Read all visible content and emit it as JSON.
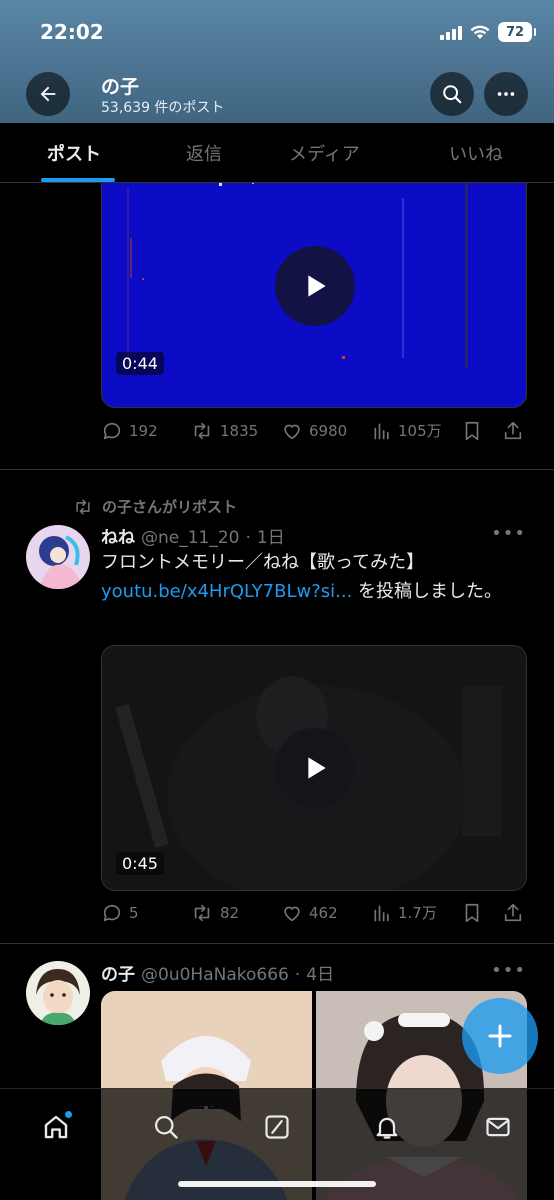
{
  "status_bar": {
    "time": "22:02",
    "battery": "72"
  },
  "header": {
    "title": "の子",
    "subtitle": "53,639 件のポスト"
  },
  "tabs": [
    {
      "label": "ポスト",
      "active": true
    },
    {
      "label": "返信",
      "active": false
    },
    {
      "label": "メディア",
      "active": false
    },
    {
      "label": "いいね",
      "active": false
    }
  ],
  "posts": [
    {
      "media": {
        "type": "video",
        "duration": "0:44",
        "color": "#0c0cc6"
      },
      "stats": {
        "replies": "192",
        "reposts": "1835",
        "likes": "6980",
        "views": "105万"
      }
    },
    {
      "repost_label": "の子さんがリポスト",
      "author": {
        "name": "ねね",
        "handle": "@ne_11_20",
        "time": "1日"
      },
      "text_before": "フロントメモリー／ねね【歌ってみた】",
      "link": "youtu.be/x4HrQLY7BLw?si...",
      "text_after": " を投稿しました。",
      "media": {
        "type": "video",
        "duration": "0:45"
      },
      "stats": {
        "replies": "5",
        "reposts": "82",
        "likes": "462",
        "views": "1.7万"
      }
    },
    {
      "author": {
        "name": "の子",
        "handle": "@0u0HaNako666",
        "time": "4日"
      },
      "media": {
        "type": "photos",
        "count": 2
      }
    }
  ],
  "bottom_nav": [
    "home-icon",
    "search-icon",
    "grok-icon",
    "notifications-icon",
    "messages-icon"
  ],
  "colors": {
    "accent": "#1d9bf0",
    "muted": "#71767b",
    "text": "#e7e9ea"
  }
}
